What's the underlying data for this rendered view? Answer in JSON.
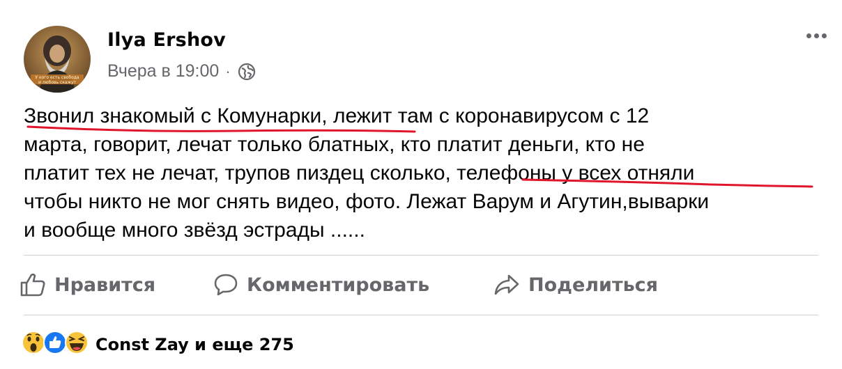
{
  "post": {
    "author": "Ilya Ershov",
    "timestamp": "Вчера в 19:00",
    "separator": "·",
    "privacy_icon": "globe-icon",
    "more_icon": "more-options-icon",
    "avatar_caption": "У кого есть свобода и любовь скажут",
    "lines": [
      "Звонил знакомый с Комунарки, лежит там с коронавирусом с 12",
      "марта, говорит, лечат только блатных, кто платит деньги, кто не",
      "платит тех не лечат, трупов пиздец сколько, телефоны у всех отняли",
      "чтобы никто не мог снять видео, фото. Лежат Варум и Агутин,выварки",
      "и вообще много звёзд эстрады ......"
    ],
    "annotation_color": "#e0152b"
  },
  "actions": {
    "like_label": "Нравится",
    "comment_label": "Комментировать",
    "share_label": "Поделиться"
  },
  "reactions": {
    "icons": [
      "wow-reaction-icon",
      "like-reaction-icon",
      "haha-reaction-icon"
    ],
    "summary": "Const Zay и еще 275"
  },
  "colors": {
    "text_primary": "#050505",
    "text_secondary": "#65676b",
    "like_blue": "#1877f2",
    "reaction_yellow": "#f7c33b"
  }
}
